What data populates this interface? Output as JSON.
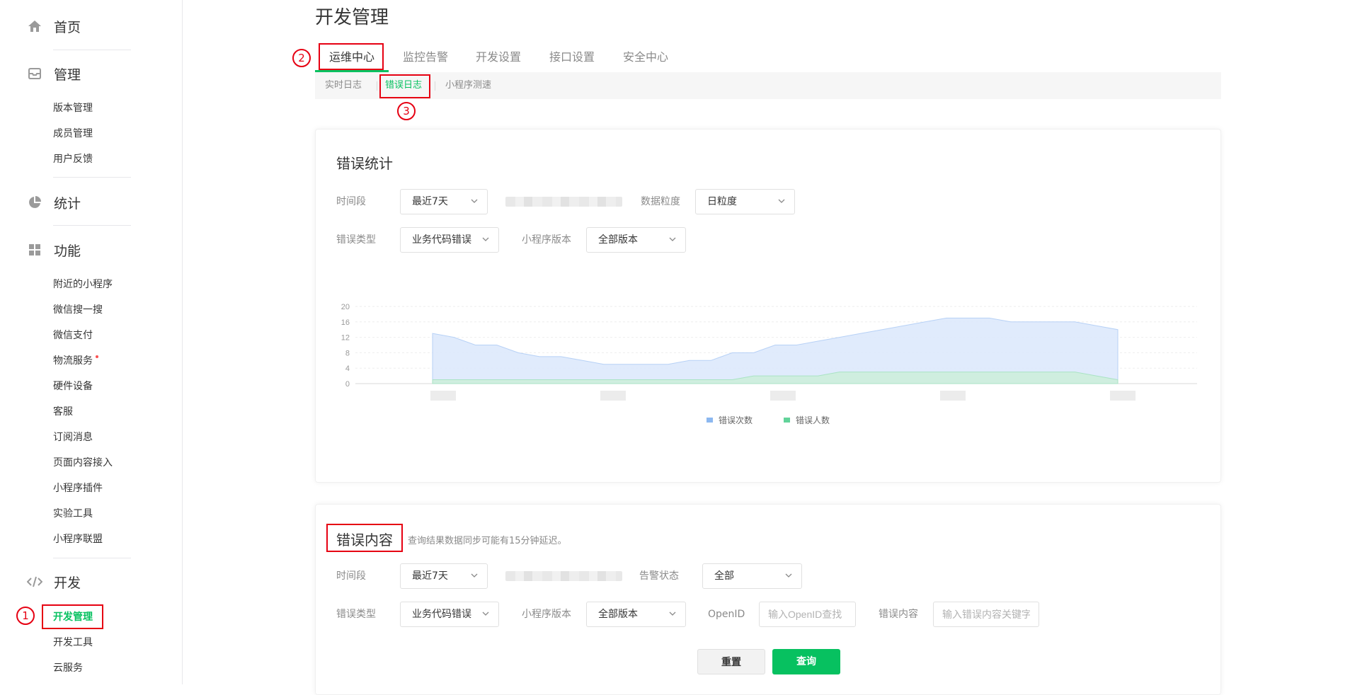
{
  "sidebar": {
    "home": {
      "label": "首页",
      "icon": "home-icon"
    },
    "manage": {
      "label": "管理",
      "icon": "inbox-icon",
      "items": [
        "版本管理",
        "成员管理",
        "用户反馈"
      ]
    },
    "stats": {
      "label": "统计",
      "icon": "pie-chart-icon"
    },
    "features": {
      "label": "功能",
      "icon": "grid-icon",
      "items": [
        "附近的小程序",
        "微信搜一搜",
        "微信支付",
        "物流服务",
        "硬件设备",
        "客服",
        "订阅消息",
        "页面内容接入",
        "小程序插件",
        "实验工具",
        "小程序联盟"
      ]
    },
    "develop": {
      "label": "开发",
      "icon": "code-icon",
      "items": [
        "开发管理",
        "开发工具",
        "云服务"
      ]
    }
  },
  "page": {
    "title": "开发管理"
  },
  "tabs": [
    "运维中心",
    "监控告警",
    "开发设置",
    "接口设置",
    "安全中心"
  ],
  "subtabs": [
    "实时日志",
    "错误日志",
    "小程序测速"
  ],
  "annotations": [
    "1",
    "2",
    "3"
  ],
  "stats_card": {
    "title": "错误统计",
    "time_label": "时间段",
    "time_value": "最近7天",
    "granularity_label": "数据粒度",
    "granularity_value": "日粒度",
    "error_type_label": "错误类型",
    "error_type_value": "业务代码错误",
    "version_label": "小程序版本",
    "version_value": "全部版本"
  },
  "content_card": {
    "title": "错误内容",
    "note": "查询结果数据同步可能有15分钟延迟。",
    "time_label": "时间段",
    "time_value": "最近7天",
    "alert_label": "告警状态",
    "alert_value": "全部",
    "error_type_label": "错误类型",
    "error_type_value": "业务代码错误",
    "version_label": "小程序版本",
    "version_value": "全部版本",
    "openid_label": "OpenID",
    "openid_placeholder": "输入OpenID查找",
    "content_label": "错误内容",
    "content_placeholder": "输入错误内容关键字",
    "reset_label": "重置",
    "query_label": "查询"
  },
  "colors": {
    "accent": "#07c160",
    "annotation": "#e60012",
    "series_count": "#8cb8f0",
    "series_users": "#62d39a"
  },
  "chart_data": {
    "type": "area",
    "ylim": [
      0,
      20
    ],
    "yticks": [
      0,
      4,
      8,
      12,
      16,
      20
    ],
    "grid": true,
    "legend_position": "bottom",
    "series": [
      {
        "name": "错误次数",
        "values": [
          13,
          12,
          10,
          10,
          8,
          7,
          7,
          6,
          5,
          5,
          5,
          5,
          6,
          6,
          8,
          8,
          10,
          10,
          11,
          12,
          13,
          14,
          15,
          16,
          17,
          17,
          17,
          16,
          16,
          16,
          16,
          15,
          14
        ]
      },
      {
        "name": "错误人数",
        "values": [
          1,
          1,
          1,
          1,
          1,
          1,
          1,
          1,
          1,
          1,
          1,
          1,
          1,
          1,
          1,
          2,
          2,
          2,
          2,
          3,
          3,
          3,
          3,
          3,
          3,
          3,
          3,
          3,
          3,
          3,
          3,
          2,
          1
        ]
      }
    ]
  }
}
